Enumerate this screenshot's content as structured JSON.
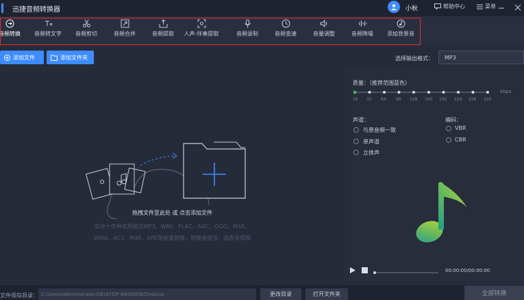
{
  "app": {
    "title": "迅捷音频转换器"
  },
  "user": {
    "name": "小秋"
  },
  "window_buttons": {
    "help": "帮助中心",
    "menu": "菜单"
  },
  "toolbar": {
    "tools": [
      {
        "label": "音频转换",
        "icon": "convert-icon"
      },
      {
        "label": "音频转文字",
        "icon": "audio-to-text-icon"
      },
      {
        "label": "音频剪切",
        "icon": "scissors-icon"
      },
      {
        "label": "音频合并",
        "icon": "merge-icon"
      },
      {
        "label": "音频提取",
        "icon": "extract-icon"
      },
      {
        "label": "人声-伴奏提取",
        "icon": "vocal-separate-icon"
      },
      {
        "label": "音频录制",
        "icon": "microphone-icon"
      },
      {
        "label": "音频变速",
        "icon": "speed-icon"
      },
      {
        "label": "音量调整",
        "icon": "volume-icon"
      },
      {
        "label": "音频降噪",
        "icon": "noise-reduction-icon"
      },
      {
        "label": "添加背景音",
        "icon": "background-music-icon"
      }
    ],
    "highlight_color": "#e0302c"
  },
  "actions": {
    "add_file": "添加文件",
    "add_folder": "添加文件夹",
    "output_format_label": "选择输出格式：",
    "output_format_value": "MP3"
  },
  "drop_area": {
    "main_text": "拖拽文件至此处 或 点击添加文件",
    "support_line1": "支持十余种常用格式MP3、WAV、FLAC、AAC、OGG、M4A、",
    "support_line2": "WMA、AC3、M4R、APE等批量转换，转换速度快，品质有保障"
  },
  "settings": {
    "quality_label": "质量：（推荐范围蓝色）",
    "quality_unit": "kbps",
    "quality_ticks": [
      "16",
      "32",
      "64",
      "96",
      "128",
      "160",
      "192",
      "224",
      "256",
      "320"
    ],
    "quality_selected_index": 0,
    "channel_label": "声道：",
    "channel_options": [
      "与原音频一致",
      "单声道",
      "立体声"
    ],
    "encoding_label": "编码：",
    "encoding_options": [
      "VBR",
      "CBR"
    ]
  },
  "player": {
    "time": "00:00:00/00:00:00",
    "progress": 0
  },
  "bottom": {
    "save_path_label": "文件保存目录：",
    "save_path_value": "C:/Users/Administrator.DESKTOP-4N5S0O6/Desktop",
    "change_dir": "更改目录",
    "open_folder": "打开文件夹",
    "convert_all": "全部转换"
  },
  "colors": {
    "accent": "#3e8cff",
    "quality_green": "#3fbf4a",
    "music_note": "#9fd13a"
  }
}
